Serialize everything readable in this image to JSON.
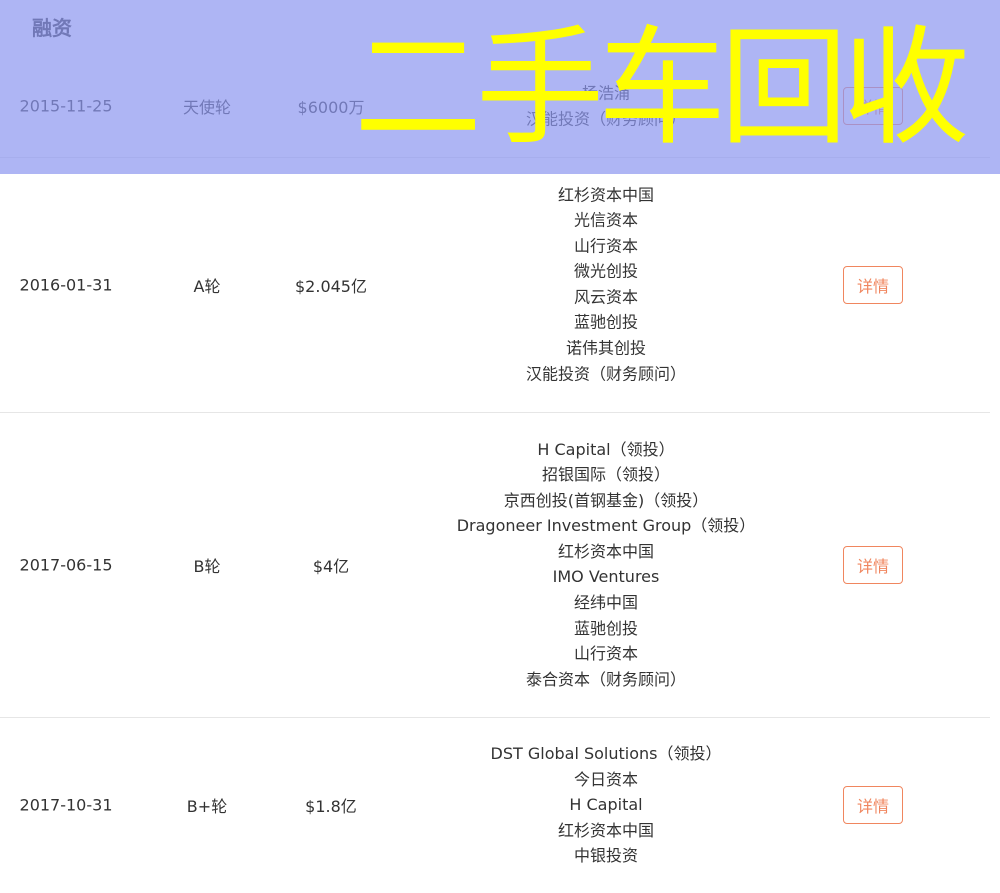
{
  "section_title": "融资",
  "watermark": "二手车回收",
  "rounds": [
    {
      "date": "2015-11-25",
      "round": "天使轮",
      "amount": "$6000万",
      "investors": [
        "杨浩涌",
        "汉能投资（财务顾问）"
      ],
      "detail_label": "详情"
    },
    {
      "date": "2016-01-31",
      "round": "A轮",
      "amount": "$2.045亿",
      "investors": [
        "红杉资本中国",
        "光信资本",
        "山行资本",
        "微光创投",
        "风云资本",
        "蓝驰创投",
        "诺伟其创投",
        "汉能投资（财务顾问）"
      ],
      "detail_label": "详情"
    },
    {
      "date": "2017-06-15",
      "round": "B轮",
      "amount": "$4亿",
      "investors": [
        "H Capital（领投）",
        "招银国际（领投）",
        "京西创投(首钢基金)（领投）",
        "Dragoneer Investment Group（领投）",
        "红杉资本中国",
        "IMO Ventures",
        "经纬中国",
        "蓝驰创投",
        "山行资本",
        "泰合资本（财务顾问）"
      ],
      "detail_label": "详情"
    },
    {
      "date": "2017-10-31",
      "round": "B+轮",
      "amount": "$1.8亿",
      "investors": [
        "DST Global Solutions（领投）",
        "今日资本",
        "H Capital",
        "红杉资本中国",
        "中银投资"
      ],
      "detail_label": "详情"
    }
  ]
}
